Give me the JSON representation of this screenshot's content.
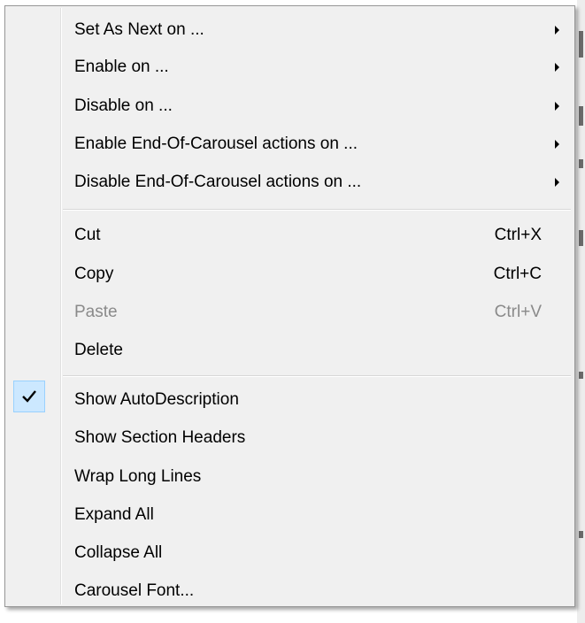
{
  "menu": {
    "submenu_items": [
      {
        "label": "Set As Next on ...",
        "icon": "submenu-arrow-icon"
      },
      {
        "label": "Enable on ...",
        "icon": "submenu-arrow-icon"
      },
      {
        "label": "Disable on ...",
        "icon": "submenu-arrow-icon"
      },
      {
        "label": "Enable End-Of-Carousel actions on ...",
        "icon": "submenu-arrow-icon"
      },
      {
        "label": "Disable End-Of-Carousel actions on ...",
        "icon": "submenu-arrow-icon"
      }
    ],
    "edit_items": [
      {
        "label": "Cut",
        "shortcut": "Ctrl+X",
        "enabled": true
      },
      {
        "label": "Copy",
        "shortcut": "Ctrl+C",
        "enabled": true
      },
      {
        "label": "Paste",
        "shortcut": "Ctrl+V",
        "enabled": false
      },
      {
        "label": "Delete",
        "shortcut": "",
        "enabled": true
      }
    ],
    "view_items": [
      {
        "label": "Show AutoDescription",
        "checked": true
      },
      {
        "label": "Show Section Headers",
        "checked": false
      },
      {
        "label": "Wrap Long Lines",
        "checked": false
      },
      {
        "label": "Expand All",
        "checked": false
      },
      {
        "label": "Collapse All",
        "checked": false
      },
      {
        "label": "Carousel Font...",
        "checked": false
      }
    ],
    "check_icon": "checkmark-icon"
  },
  "colors": {
    "menu_bg": "#f0f0f0",
    "disabled_text": "#8a8a8a",
    "check_highlight": "#cce8ff",
    "check_border": "#99d1ff"
  }
}
